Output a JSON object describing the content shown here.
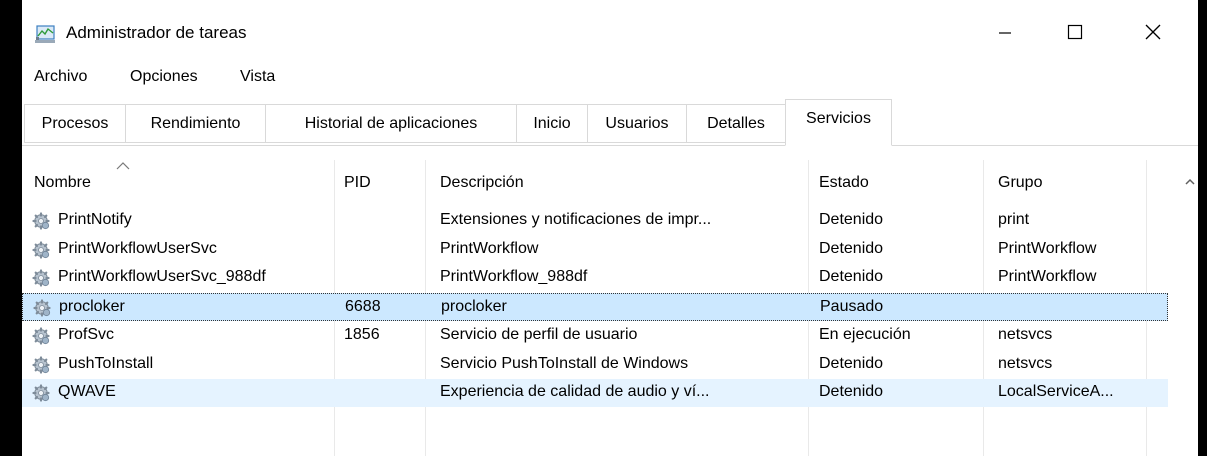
{
  "window": {
    "title": "Administrador de tareas",
    "controls": {
      "minimize": "minimize-icon",
      "maximize": "maximize-icon",
      "close": "close-icon"
    }
  },
  "menu": [
    {
      "label": "Archivo"
    },
    {
      "label": "Opciones"
    },
    {
      "label": "Vista"
    }
  ],
  "tabs": [
    {
      "label": "Procesos"
    },
    {
      "label": "Rendimiento"
    },
    {
      "label": "Historial de aplicaciones"
    },
    {
      "label": "Inicio"
    },
    {
      "label": "Usuarios"
    },
    {
      "label": "Detalles"
    },
    {
      "label": "Servicios",
      "active": true
    }
  ],
  "table": {
    "columns": [
      {
        "label": "Nombre"
      },
      {
        "label": "PID"
      },
      {
        "label": "Descripción"
      },
      {
        "label": "Estado"
      },
      {
        "label": "Grupo"
      }
    ],
    "rows": [
      {
        "name": "PrintNotify",
        "pid": "",
        "description": "Extensiones y notificaciones de impr...",
        "state": "Detenido",
        "group": "print"
      },
      {
        "name": "PrintWorkflowUserSvc",
        "pid": "",
        "description": "PrintWorkflow",
        "state": "Detenido",
        "group": "PrintWorkflow"
      },
      {
        "name": "PrintWorkflowUserSvc_988df",
        "pid": "",
        "description": "PrintWorkflow_988df",
        "state": "Detenido",
        "group": "PrintWorkflow"
      },
      {
        "name": "procloker",
        "pid": "6688",
        "description": "procloker",
        "state": "Pausado",
        "group": ""
      },
      {
        "name": "ProfSvc",
        "pid": "1856",
        "description": "Servicio de perfil de usuario",
        "state": "En ejecución",
        "group": "netsvcs"
      },
      {
        "name": "PushToInstall",
        "pid": "",
        "description": "Servicio PushToInstall de Windows",
        "state": "Detenido",
        "group": "netsvcs"
      },
      {
        "name": "QWAVE",
        "pid": "",
        "description": "Experiencia de calidad de audio y ví...",
        "state": "Detenido",
        "group": "LocalServiceA..."
      }
    ]
  },
  "colors": {
    "selected": "#cce8ff",
    "hover": "#e5f3ff",
    "border": "#d9d9d9"
  }
}
